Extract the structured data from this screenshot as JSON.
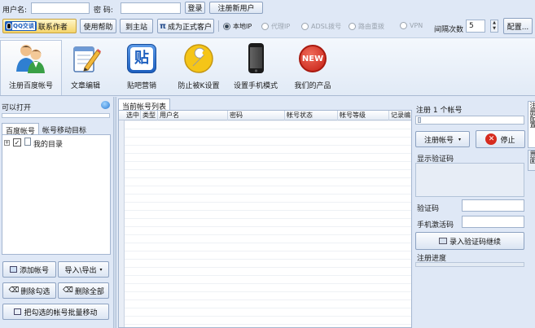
{
  "login": {
    "username_label": "用户名:",
    "password_label": "密  码:",
    "login_button": "登录",
    "register_button": "注册新用户",
    "qq_badge": "QQ交谈",
    "contact_author": "联系作者",
    "help_button": "使用帮助",
    "home_button": "到主站",
    "upgrade_button": "成为正式客户"
  },
  "ip_modes": [
    {
      "label": "本地IP",
      "selected": true
    },
    {
      "label": "代理IP",
      "selected": false
    },
    {
      "label": "ADSL拨号",
      "selected": false
    },
    {
      "label": "路由重拨",
      "selected": false
    },
    {
      "label": "VPN",
      "selected": false
    }
  ],
  "interval": {
    "label": "间隔次数",
    "value": "5"
  },
  "config_button": "配置...",
  "toolbar": [
    {
      "label": "注册百度帐号",
      "icon": "users-icon"
    },
    {
      "label": "文章编辑",
      "icon": "notepad-pencil-icon"
    },
    {
      "label": "贴吧营销",
      "icon": "tieba-icon",
      "glyph": "贴"
    },
    {
      "label": "防止被K设置",
      "icon": "wrench-icon"
    },
    {
      "label": "设置手机模式",
      "icon": "phone-icon"
    },
    {
      "label": "我们的产品",
      "icon": "new-badge-icon",
      "glyph": "NEW"
    }
  ],
  "left": {
    "status": "可以打开",
    "tabs": [
      "百度帐号",
      "帐号移动目标"
    ],
    "tree_root": "我的目录",
    "tree_checked": true,
    "buttons": {
      "add": "添加帐号",
      "import_export": "导入\\导出",
      "delete_checked": "删除勾选",
      "delete_all": "删除全部",
      "batch_move": "把勾选的帐号批量移动"
    }
  },
  "center": {
    "tab": "当前帐号列表",
    "columns": [
      "选中",
      "类型",
      "用户名",
      "密码",
      "帐号状态",
      "帐号等级",
      "记录编"
    ]
  },
  "right": {
    "progress_title": "注册 1 个帐号",
    "progress": 0,
    "register_button": "注册帐号",
    "stop_button": "停止",
    "captcha_label": "显示验证码",
    "code_label": "验证码",
    "code_value": "",
    "sms_label": "手机激活码",
    "sms_value": "",
    "continue_button": "录入验证码继续",
    "reg_progress_label": "注册进度",
    "reg_progress": 0,
    "side_tab_1": "注册配置",
    "side_tab_2": "界面"
  }
}
